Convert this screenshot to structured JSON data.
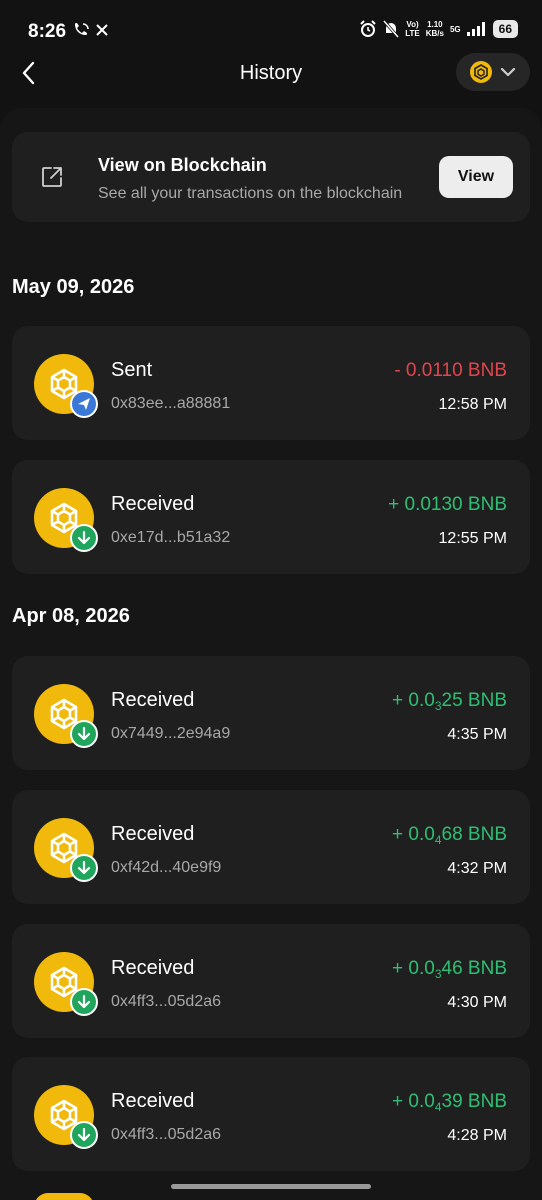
{
  "status_bar": {
    "time": "8:26",
    "network_top": "Vo)",
    "network_bottom": "LTE",
    "speed_top": "1.10",
    "speed_bottom": "KB/s",
    "signal": "5G",
    "battery": "66"
  },
  "header": {
    "title": "History",
    "network_icon": "bnb-icon"
  },
  "blockchain_card": {
    "title": "View on Blockchain",
    "subtitle": "See all your transactions on the blockchain",
    "button_label": "View"
  },
  "groups": [
    {
      "date": "May 09, 2026",
      "transactions": [
        {
          "type": "Sent",
          "hash": "0x83ee...a88881",
          "amount_prefix": "- 0.0110",
          "amount_sub": "",
          "amount_suffix": " BNB",
          "direction": "out",
          "time": "12:58 PM"
        },
        {
          "type": "Received",
          "hash": "0xe17d...b51a32",
          "amount_prefix": "+ 0.0130",
          "amount_sub": "",
          "amount_suffix": " BNB",
          "direction": "in",
          "time": "12:55 PM"
        }
      ]
    },
    {
      "date": "Apr 08, 2026",
      "transactions": [
        {
          "type": "Received",
          "hash": "0x7449...2e94a9",
          "amount_prefix": "+ 0.0",
          "amount_sub": "3",
          "amount_suffix": "25 BNB",
          "direction": "in",
          "time": "4:35 PM"
        },
        {
          "type": "Received",
          "hash": "0xf42d...40e9f9",
          "amount_prefix": "+ 0.0",
          "amount_sub": "4",
          "amount_suffix": "68 BNB",
          "direction": "in",
          "time": "4:32 PM"
        },
        {
          "type": "Received",
          "hash": "0x4ff3...05d2a6",
          "amount_prefix": "+ 0.0",
          "amount_sub": "3",
          "amount_suffix": "46 BNB",
          "direction": "in",
          "time": "4:30 PM"
        },
        {
          "type": "Received",
          "hash": "0x4ff3...05d2a6",
          "amount_prefix": "+ 0.0",
          "amount_sub": "4",
          "amount_suffix": "39 BNB",
          "direction": "in",
          "time": "4:28 PM"
        }
      ]
    }
  ],
  "colors": {
    "background": "#121212",
    "card": "#1f1f1f",
    "sent": "#e0464e",
    "received": "#2fbf73",
    "bnb": "#f0b90b"
  }
}
